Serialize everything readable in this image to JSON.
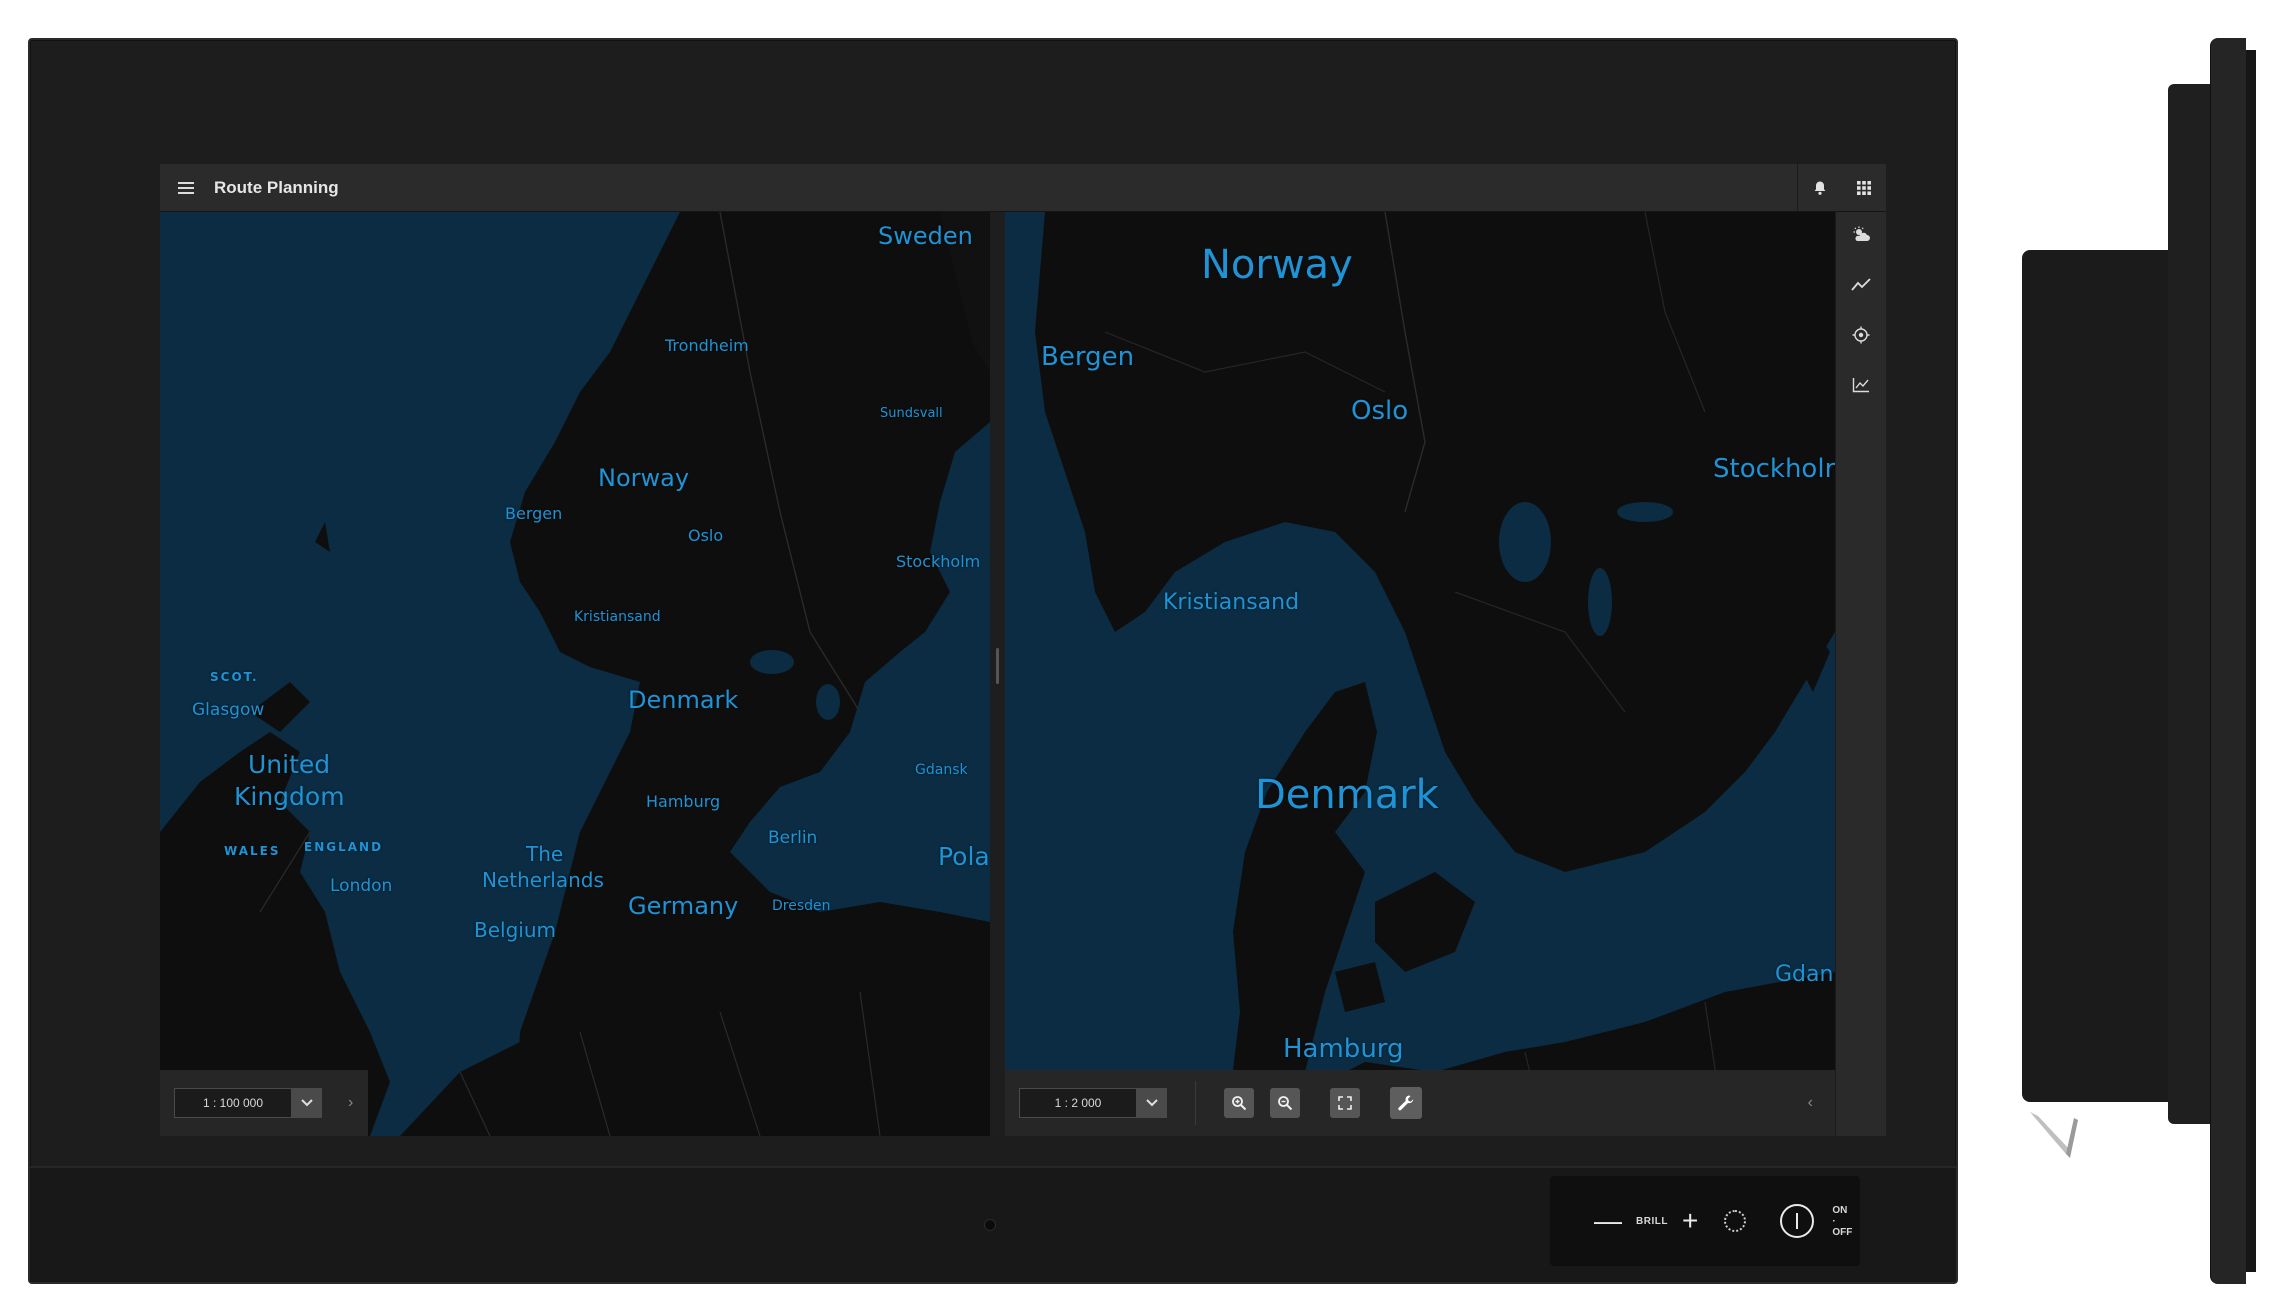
{
  "app": {
    "title": "Route Planning"
  },
  "header_icons": [
    "bell-icon",
    "apps-grid-icon"
  ],
  "left_map": {
    "scale": "1 : 100 000",
    "labels": {
      "sweden": "Sweden",
      "trondheim": "Trondheim",
      "sundsvall": "Sundsvall",
      "norway": "Norway",
      "bergen": "Bergen",
      "oslo": "Oslo",
      "stockholm": "Stockholm",
      "kristiansand": "Kristiansand",
      "scot": "SCOT.",
      "glasgow": "Glasgow",
      "denmark": "Denmark",
      "united": "United",
      "kingdom": "Kingdom",
      "gdansk": "Gdansk",
      "hamburg": "Hamburg",
      "wales": "WALES",
      "england": "ENGLAND",
      "the": "The",
      "netherlands": "Netherlands",
      "berlin": "Berlin",
      "pola": "Pola",
      "london": "London",
      "germany": "Germany",
      "dresden": "Dresden",
      "belgium": "Belgium"
    }
  },
  "right_map": {
    "scale": "1 : 2 000",
    "labels": {
      "norway": "Norway",
      "bergen": "Bergen",
      "oslo": "Oslo",
      "stockholm": "Stockholn",
      "kristiansand": "Kristiansand",
      "denmark": "Denmark",
      "gdansk": "Gdan",
      "hamburg": "Hamburg"
    },
    "tools": [
      "zoom-in-icon",
      "zoom-out-icon",
      "fit-screen-icon",
      "wrench-icon"
    ]
  },
  "rail_icons": [
    "weather-icon",
    "trend-line-icon",
    "target-icon",
    "line-chart-icon"
  ],
  "hardware": {
    "brill_label": "BRILL",
    "minus": "—",
    "plus": "+",
    "on": "ON",
    "dot": "·",
    "off": "OFF"
  },
  "colors": {
    "sea": "#0b2c42",
    "land": "#0e0e0e",
    "label": "#1e93d6",
    "header": "#2b2b2b"
  }
}
